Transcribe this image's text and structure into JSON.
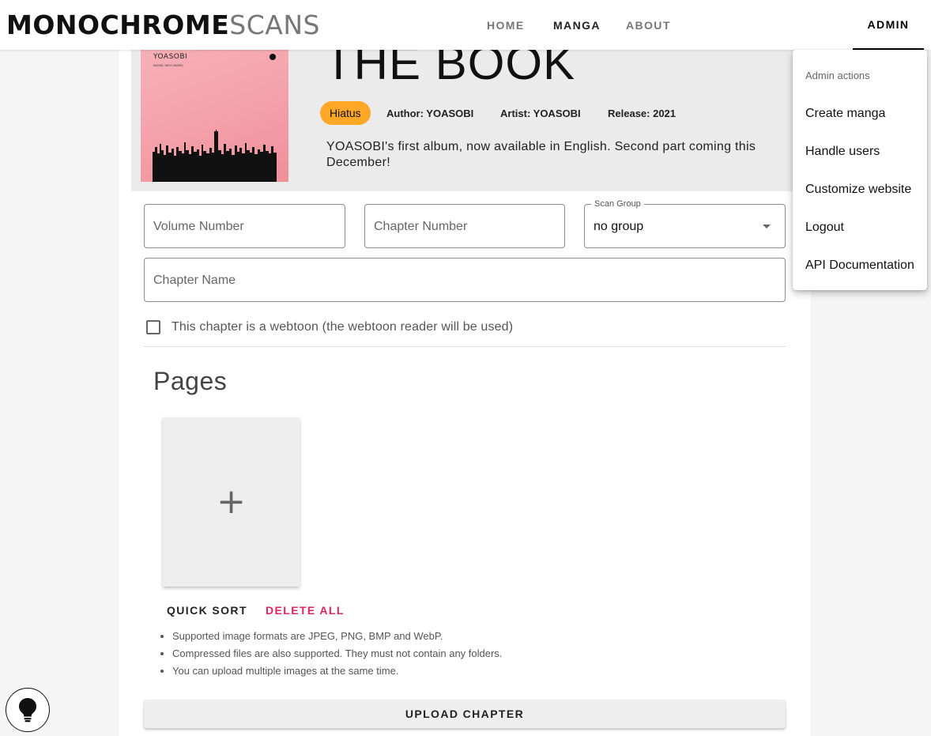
{
  "app": {
    "logo_part1": "MONOCHROME",
    "logo_part2": "SCANS"
  },
  "nav": {
    "home": "HOME",
    "manga": "MANGA",
    "about": "ABOUT",
    "admin": "ADMIN"
  },
  "manga": {
    "title": "THE BOOK",
    "status": "Hiatus",
    "author": "Author: YOASOBI",
    "artist": "Artist: YOASOBI",
    "release": "Release: 2021",
    "description": "YOASOBI's first album, now available in English. Second part coming this December!",
    "cover_text": "YOASOBI",
    "cover_subtext": "NOVEL INTO MUSIC",
    "status_color": "#ffa726"
  },
  "form": {
    "volume_placeholder": "Volume Number",
    "chapter_placeholder": "Chapter Number",
    "scan_group_label": "Scan Group",
    "scan_group_value": "no group",
    "chapter_name_placeholder": "Chapter Name",
    "webtoon_label": "This chapter is a webtoon (the webtoon reader will be used)",
    "webtoon_checked": false
  },
  "pages": {
    "title": "Pages",
    "add_icon": "+",
    "quick_sort": "QUICK SORT",
    "delete_all": "DELETE ALL",
    "delete_color": "#e0245e",
    "hints": [
      "Supported image formats are JPEG, PNG, BMP and WebP.",
      "Compressed files are also supported. They must not contain any folders.",
      "You can upload multiple images at the same time."
    ],
    "upload": "UPLOAD CHAPTER"
  },
  "admin_menu": {
    "header": "Admin actions",
    "items": [
      "Create manga",
      "Handle users",
      "Customize website",
      "Logout",
      "API Documentation"
    ]
  },
  "icons": {
    "theme": "lightbulb-icon",
    "dropdown": "chevron-down-icon",
    "add": "plus-icon"
  }
}
